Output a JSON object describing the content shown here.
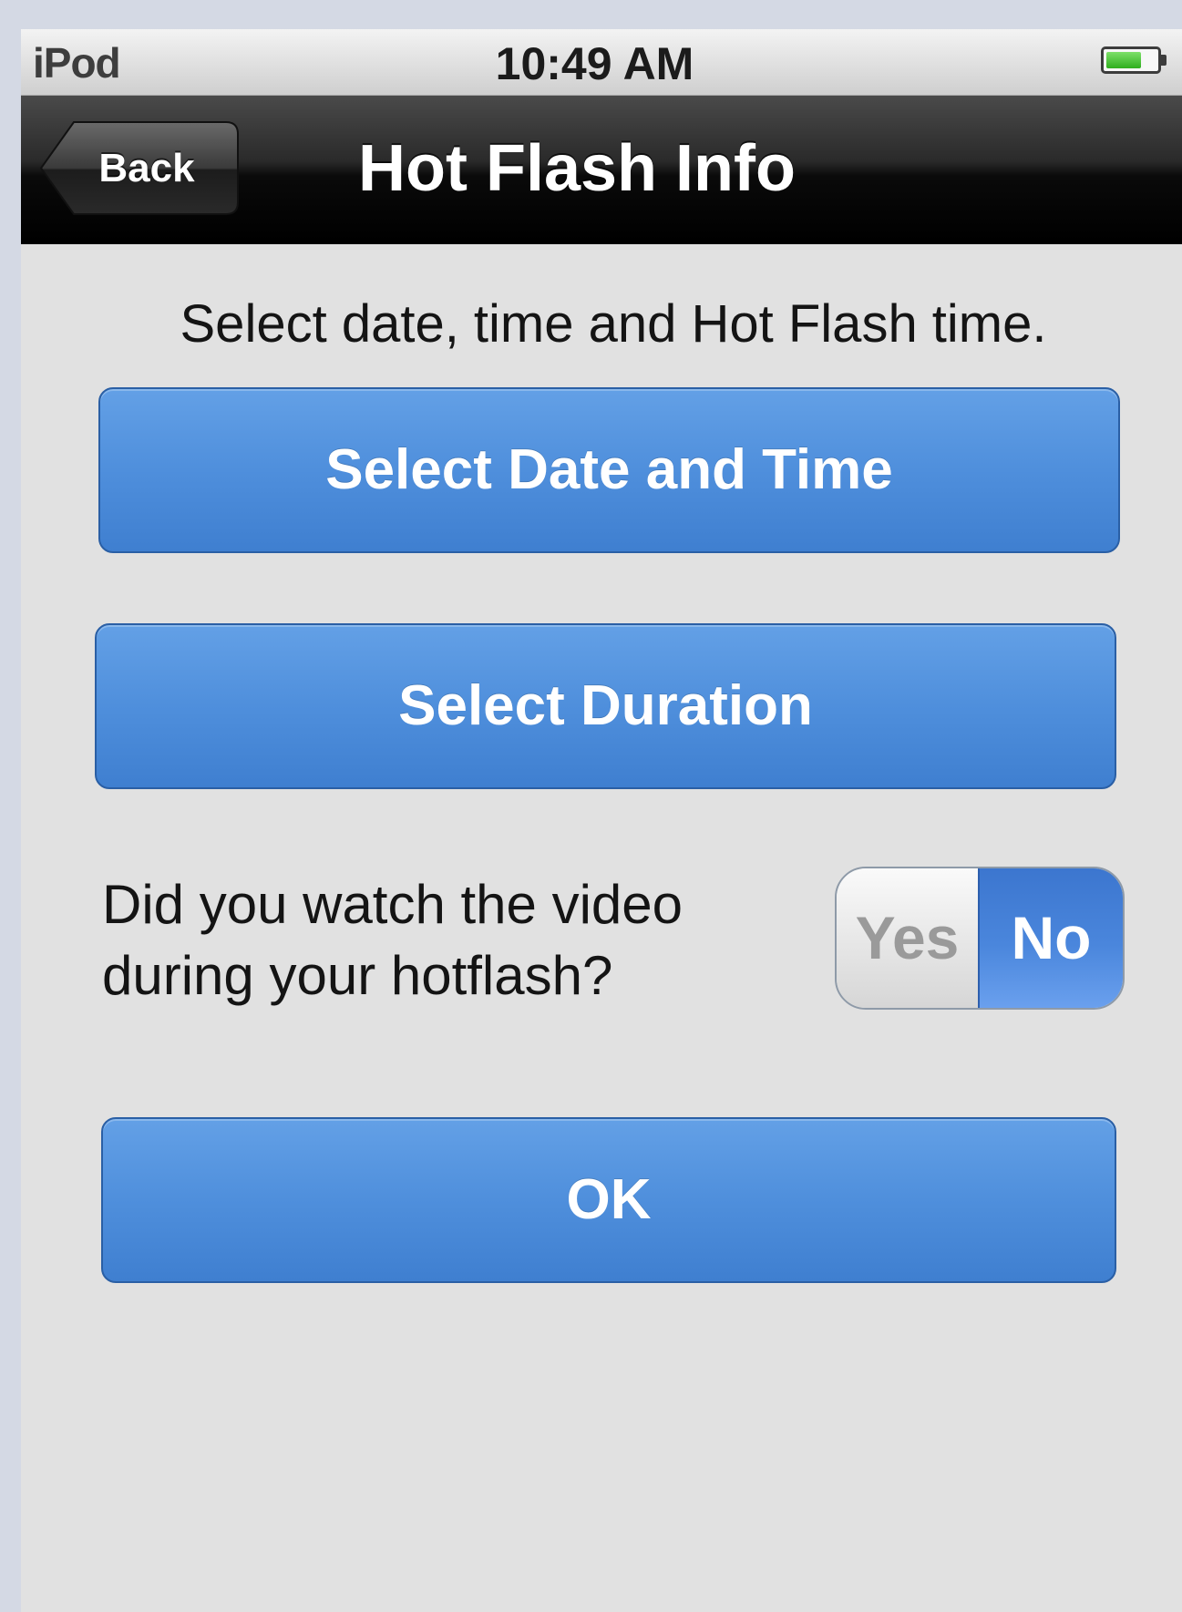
{
  "status_bar": {
    "carrier": "iPod",
    "time": "10:49 AM",
    "battery_level": 0.7
  },
  "nav_bar": {
    "back_label": "Back",
    "title": "Hot Flash Info"
  },
  "content": {
    "instruction": "Select date, time and Hot Flash time.",
    "select_date_time_label": "Select Date and Time",
    "select_duration_label": "Select Duration",
    "question_line1": "Did you watch the video",
    "question_line2": "during your hotflash?",
    "toggle": {
      "yes_label": "Yes",
      "no_label": "No",
      "selected": "No"
    },
    "ok_label": "OK"
  },
  "colors": {
    "button_blue": "#4f8fdc",
    "nav_black": "#000000",
    "background_gray": "#e1e1e1"
  }
}
